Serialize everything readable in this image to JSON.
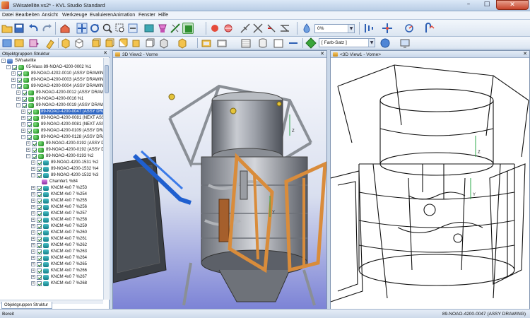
{
  "window": {
    "title": "SWsatellite.vs2* - KVL Studio Standard",
    "controls": {
      "minimize": "–",
      "maximize": "□",
      "close": "✕"
    }
  },
  "menu": [
    "Datei",
    "Bearbeiten",
    "Ansicht",
    "Werkzeuge",
    "Evaluieren",
    "Animation",
    "Fenster",
    "Hilfe"
  ],
  "toolbar": {
    "opacity_value": "0%",
    "color_set_placeholder": "[ Farb-Satz ]",
    "icons_row1": [
      "open-folder-icon",
      "save-icon",
      "undo-icon",
      "redo-icon",
      "home-view-icon",
      "pan-icon",
      "rotate-icon",
      "zoom-icon",
      "zoom-window-icon",
      "fit-all-icon",
      "select-icon",
      "selection-filter-icon",
      "measure-icon",
      "annotation-icon",
      "explode-icon",
      "section-icon",
      "light-icon",
      "material-icon",
      "transparency-icon",
      "cut-plane-icon",
      "move-icon",
      "rotate-part-icon"
    ],
    "icons_row2": [
      "new-icon",
      "reset-icon",
      "display-mode-icon",
      "view-front-icon",
      "view-back-icon",
      "view-left-icon",
      "view-right-icon",
      "view-top-icon",
      "view-iso-icon",
      "box-icon",
      "shaded-icon",
      "cylinder-icon",
      "wireframe-icon",
      "color-set-icon",
      "sphere-icon",
      "screen-icon"
    ]
  },
  "tree_panel": {
    "title": "Objektgruppen Struktur",
    "close": "✕",
    "tab_label": "Objektgruppen Struktur",
    "rows": [
      {
        "level": 0,
        "expander": "-",
        "icon": "root",
        "check": false,
        "label": "SWsatellite"
      },
      {
        "level": 1,
        "expander": "-",
        "icon": "assy",
        "check": true,
        "label": "05-Mass 89-NOAO-4200-0002 %1"
      },
      {
        "level": 2,
        "expander": "+",
        "icon": "assy",
        "check": true,
        "label": "89-NOAO-4202-0010 (ASSY DRAWING) %1"
      },
      {
        "level": 2,
        "expander": "+",
        "icon": "assy",
        "check": true,
        "label": "89-NOAO-4200-0003 (ASSY DRAWING) %"
      },
      {
        "level": 2,
        "expander": "-",
        "icon": "assy",
        "check": true,
        "label": "89-NOAO-4200-0004 (ASSY DRAWING) %"
      },
      {
        "level": 3,
        "expander": "+",
        "icon": "assy",
        "check": true,
        "label": "89-NOAO-4200-0012 (ASSY DRAWING"
      },
      {
        "level": 3,
        "expander": "+",
        "icon": "assy",
        "check": true,
        "label": "89-NOAO-4200-0016 %1"
      },
      {
        "level": 3,
        "expander": "-",
        "icon": "assy",
        "check": true,
        "label": "89-NOAO-4200-0019 (ASSY DRAWINS"
      },
      {
        "level": 4,
        "expander": "+",
        "icon": "assy",
        "check": true,
        "label": "89-NOAO-4200-0047 (ASSY DRAW",
        "selected": true
      },
      {
        "level": 4,
        "expander": "+",
        "icon": "assy",
        "check": true,
        "label": "89-NOAO-4200-0081 (NEXT ASSY"
      },
      {
        "level": 4,
        "expander": "+",
        "icon": "assy",
        "check": true,
        "label": "89-NOAO-4200-0081 (NEXT ASSY"
      },
      {
        "level": 4,
        "expander": "+",
        "icon": "assy",
        "check": true,
        "label": "89-NOAO-4200-0109 (ASSY DRAV"
      },
      {
        "level": 4,
        "expander": "-",
        "icon": "assy",
        "check": true,
        "label": "89-NOAO-4200-0128 (ASSY DRAWI"
      },
      {
        "level": 5,
        "expander": "+",
        "icon": "assy",
        "check": true,
        "label": "89-NOAO-4200-0192 (ASSY DR"
      },
      {
        "level": 5,
        "expander": "+",
        "icon": "assy",
        "check": true,
        "label": "89-NOAO-4200-0192 (ASSY DR"
      },
      {
        "level": 5,
        "expander": "-",
        "icon": "assy",
        "check": true,
        "label": "89-NOAO-4200-0193 %2"
      },
      {
        "level": 6,
        "expander": "+",
        "icon": "part",
        "check": true,
        "label": "89-NOAO-4200-1531 %2"
      },
      {
        "level": 6,
        "expander": "+",
        "icon": "part",
        "check": true,
        "label": "89-NOAO-4200-1532 %4"
      },
      {
        "level": 6,
        "expander": "-",
        "icon": "part",
        "check": true,
        "label": "89-NOAO-4200-1532 %3"
      },
      {
        "level": 7,
        "expander": "",
        "icon": "feat",
        "check": false,
        "label": "Chamfer1 %84"
      },
      {
        "level": 6,
        "expander": "+",
        "icon": "part",
        "check": true,
        "label": "KNCM 4x0 7 %253"
      },
      {
        "level": 6,
        "expander": "+",
        "icon": "part",
        "check": true,
        "label": "KNCM 4x0 7 %254"
      },
      {
        "level": 6,
        "expander": "+",
        "icon": "part",
        "check": true,
        "label": "KNCM 4x0 7 %255"
      },
      {
        "level": 6,
        "expander": "+",
        "icon": "part",
        "check": true,
        "label": "KNCM 4x0 7 %256"
      },
      {
        "level": 6,
        "expander": "+",
        "icon": "part",
        "check": true,
        "label": "KNCM 4x0 7 %257"
      },
      {
        "level": 6,
        "expander": "+",
        "icon": "part",
        "check": true,
        "label": "KNCM 4x0 7 %258"
      },
      {
        "level": 6,
        "expander": "+",
        "icon": "part",
        "check": true,
        "label": "KNCM 4x0 7 %259"
      },
      {
        "level": 6,
        "expander": "+",
        "icon": "part",
        "check": true,
        "label": "KNCM 4x0 7 %260"
      },
      {
        "level": 6,
        "expander": "+",
        "icon": "part",
        "check": true,
        "label": "KNCM 4x0 7 %261"
      },
      {
        "level": 6,
        "expander": "+",
        "icon": "part",
        "check": true,
        "label": "KNCM 4x0 7 %262"
      },
      {
        "level": 6,
        "expander": "+",
        "icon": "part",
        "check": true,
        "label": "KNCM 4x0 7 %263"
      },
      {
        "level": 6,
        "expander": "+",
        "icon": "part",
        "check": true,
        "label": "KNCM 4x0 7 %264"
      },
      {
        "level": 6,
        "expander": "+",
        "icon": "part",
        "check": true,
        "label": "KNCM 4x0 7 %265"
      },
      {
        "level": 6,
        "expander": "+",
        "icon": "part",
        "check": true,
        "label": "KNCM 4x0 7 %266"
      },
      {
        "level": 6,
        "expander": "+",
        "icon": "part",
        "check": true,
        "label": "KNCM 4x0 7 %267"
      },
      {
        "level": 6,
        "expander": "+",
        "icon": "part",
        "check": true,
        "label": "KNCM 4x0 7 %268"
      }
    ]
  },
  "viewports": [
    {
      "title": "3D View2 - Vorne",
      "close": "✕",
      "render": "shaded",
      "background_bottom": "#7c83d6"
    },
    {
      "title": "<3D View1 - Vorne>",
      "close": "✕",
      "render": "hidden-line",
      "background_bottom": "#ffffff"
    }
  ],
  "statusbar": {
    "left": "Bereit",
    "right": "89-NOAO-4200-0047 (ASSY DRAWING)"
  },
  "colors": {
    "selection": "#3168c4",
    "titlebar": "#b9cde5",
    "strut_shaded": "#d98c3b",
    "tube_blue": "#1f5fcf",
    "frame_gray": "#8a8f96"
  }
}
